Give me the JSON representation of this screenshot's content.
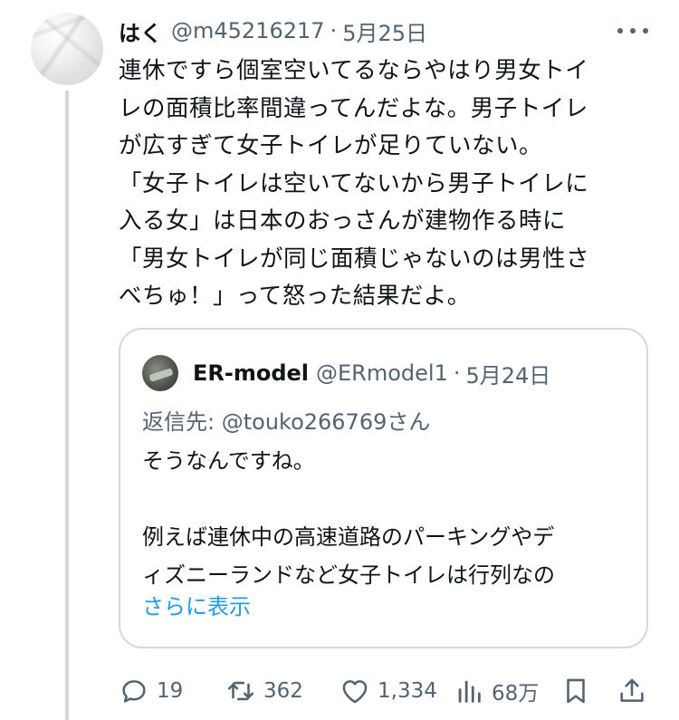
{
  "tweet": {
    "name": "はく",
    "handle": "@m45216217",
    "separator": "·",
    "date": "5月25日",
    "text": "連休ですら個室空いてるならやはり男女トイ\nレの面積比率間違ってんだよな。男子トイレ\nが広すぎて女子トイレが足りていない。\n「女子トイレは空いてないから男子トイレに\n入る女」は日本のおっさんが建物作る時に\n「男女トイレが同じ面積じゃないのは男性さ\nべちゅ！」って怒った結果だよ。"
  },
  "quote": {
    "name": "ER-model",
    "handle": "@ERmodel1",
    "separator": "·",
    "date": "5月24日",
    "reply_prefix": "返信先: ",
    "reply_to": "@touko266769",
    "reply_suffix": "さん",
    "text": "そうなんですね。\n\n例えば連休中の高速道路のパーキングやデ\nィズニーランドなど女子トイレは行列なの",
    "show_more": "さらに表示"
  },
  "actions": {
    "replies": "19",
    "retweets": "362",
    "likes": "1,334",
    "views": "68万"
  },
  "icons": {
    "reply": "reply-icon",
    "retweet": "retweet-icon",
    "like": "heart-icon",
    "views": "views-icon",
    "bookmark": "bookmark-icon",
    "share": "share-icon",
    "more": "more-icon"
  },
  "colors": {
    "text": "#0f1419",
    "muted": "#536471",
    "link": "#1d9bf0",
    "border": "#cfd9de"
  }
}
